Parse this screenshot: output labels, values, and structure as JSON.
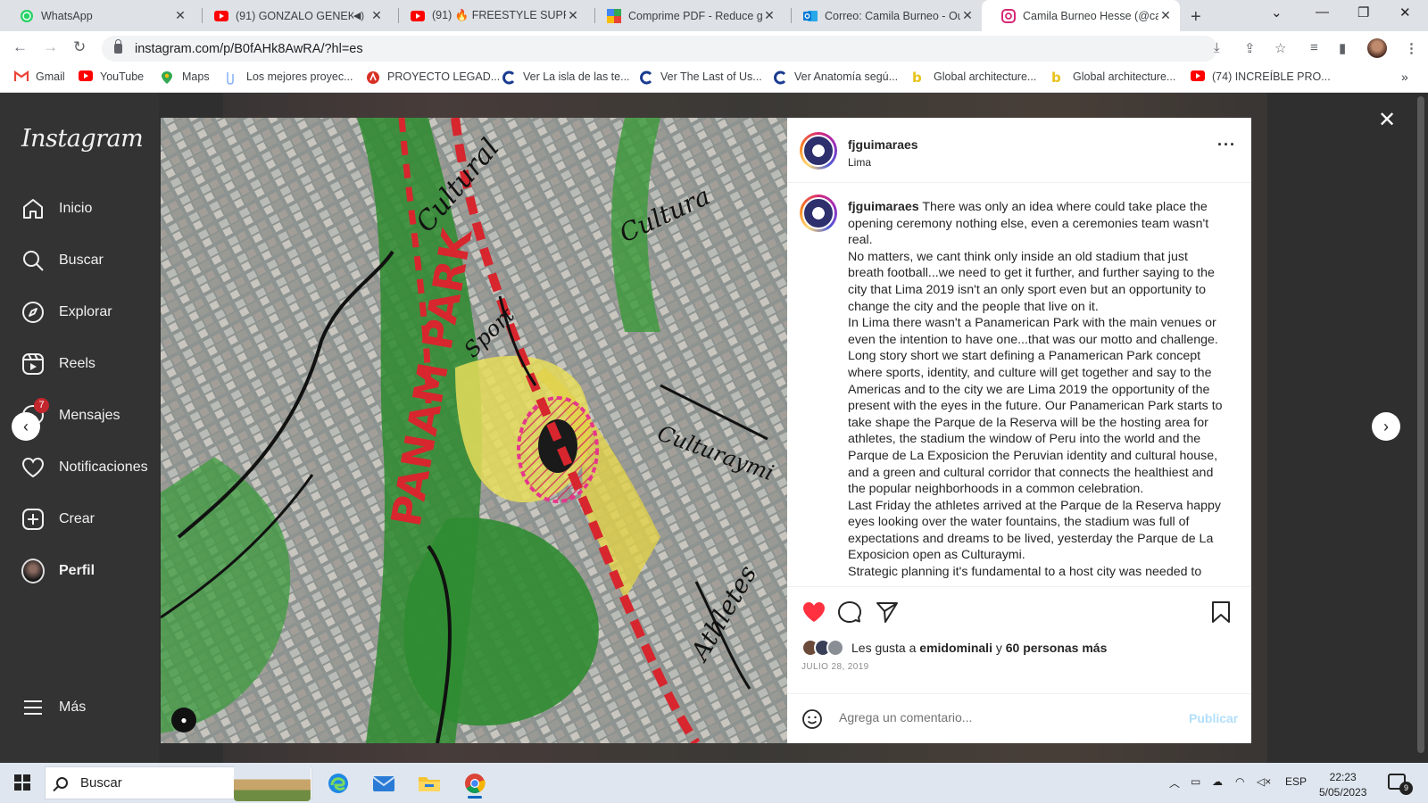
{
  "browser": {
    "tabs": [
      {
        "title": "WhatsApp",
        "icon": "whatsapp-icon",
        "color": "#25d366"
      },
      {
        "title": "(91) GONZALO GENEK",
        "icon": "youtube-icon",
        "color": "#ff0000",
        "audio": true
      },
      {
        "title": "(91) 🔥 FREESTYLE SUPREM",
        "icon": "youtube-icon",
        "color": "#ff0000"
      },
      {
        "title": "Comprime PDF - Reduce gr",
        "icon": "ilovepdf-icon",
        "color": "#e5322d"
      },
      {
        "title": "Correo: Camila Burneo - Ou",
        "icon": "outlook-icon",
        "color": "#0078d4"
      },
      {
        "title": "Camila Burneo Hesse (@ca",
        "icon": "instagram-icon",
        "color": "#d62976",
        "active": true
      }
    ],
    "url": "instagram.com/p/B0fAHk8AwRA/?hl=es",
    "bookmarks": [
      {
        "label": "Gmail",
        "icon": "gmail-icon",
        "color": "#ea4335"
      },
      {
        "label": "YouTube",
        "icon": "youtube-icon",
        "color": "#ff0000"
      },
      {
        "label": "Maps",
        "icon": "maps-icon",
        "color": "#34a853"
      },
      {
        "label": "Los mejores proyec...",
        "icon": "bookmark-site-icon",
        "color": "#8ab4f8"
      },
      {
        "label": "PROYECTO LEGAD...",
        "icon": "bookmark-site-icon",
        "color": "#d93025"
      },
      {
        "label": "Ver La isla de las te...",
        "icon": "cuevana-icon",
        "color": "#1a3c8f"
      },
      {
        "label": "Ver The Last of Us...",
        "icon": "cuevana-icon",
        "color": "#1a3c8f"
      },
      {
        "label": "Ver Anatomía segú...",
        "icon": "cuevana-icon",
        "color": "#1a3c8f"
      },
      {
        "label": "Global architecture...",
        "icon": "b-icon",
        "color": "#e8c21a"
      },
      {
        "label": "Global architecture...",
        "icon": "b-icon",
        "color": "#e8c21a"
      },
      {
        "label": "(74) INCREÍBLE PRO...",
        "icon": "youtube-icon",
        "color": "#ff0000"
      }
    ]
  },
  "instagram": {
    "logo": "Instagram",
    "nav": [
      {
        "label": "Inicio",
        "icon": "home-icon"
      },
      {
        "label": "Buscar",
        "icon": "search-icon"
      },
      {
        "label": "Explorar",
        "icon": "compass-icon"
      },
      {
        "label": "Reels",
        "icon": "reels-icon"
      },
      {
        "label": "Mensajes",
        "icon": "messenger-icon"
      },
      {
        "label": "Notificaciones",
        "icon": "heart-icon"
      },
      {
        "label": "Crear",
        "icon": "plus-square-icon"
      },
      {
        "label": "Perfil",
        "icon": "profile-avatar"
      }
    ],
    "messages_badge": "7",
    "more_label": "Más",
    "post": {
      "username": "fjguimaraes",
      "location": "Lima",
      "caption_user": "fjguimaraes",
      "caption_paragraphs": [
        "There was only an idea where could take place the opening ceremony nothing else, even a ceremonies team wasn't real.",
        "No matters, we cant think only inside an old stadium that just breath football...we need to get it further, and further saying to the city that Lima 2019 isn't an only sport even but an opportunity to change the city and the people that live on it.",
        "In Lima there wasn't a Panamerican Park with the main venues or even the intention to have one...that was our motto and challenge. Long story short we start defining a Panamerican Park concept where sports, identity, and culture will get together and say to the Americas and to the city we are Lima 2019 the opportunity of the present with the eyes in the future. Our Panamerican Park starts to take shape the Parque de la Reserva will be the hosting area for athletes, the stadium the window of Peru into the world and the Parque de La Exposicion the Peruvian identity and cultural house, and a green and cultural corridor that connects the healthiest and the popular neighborhoods in a common celebration.",
        "Last Friday the athletes arrived at the Parque de la Reserva happy eyes looking over the water fountains, the stadium was full of expectations and dreams to be lived, yesterday the Parque de La Exposicion open as Culturaymi.",
        "Strategic planning it's fundamental to a host city was needed to"
      ],
      "likes_prefix": "Les gusta a",
      "likes_user": "emidominali",
      "likes_conjunction": "y",
      "likes_others": "60 personas más",
      "date": "JULIO 28, 2019",
      "comment_placeholder": "Agrega un comentario...",
      "publish_label": "Publicar",
      "image_labels": [
        "PANAM PARK",
        "Cultural",
        "Cultura",
        "Sport",
        "Culturaymi",
        "Athletes"
      ]
    }
  },
  "taskbar": {
    "search_label": "Buscar",
    "language": "ESP",
    "time": "22:23",
    "date": "5/05/2023",
    "notifications": "9"
  }
}
